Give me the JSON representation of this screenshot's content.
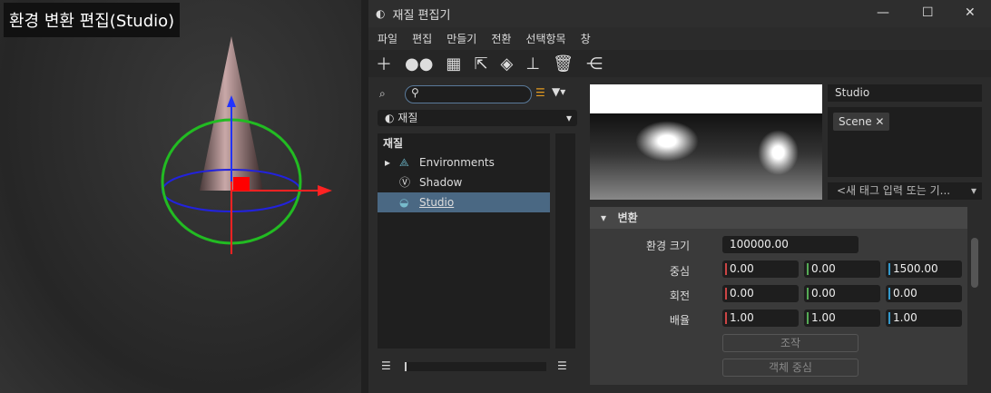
{
  "viewport": {
    "title": "환경 변환 편집(Studio)"
  },
  "window": {
    "title": "재질 편집기",
    "menu": [
      "파일",
      "편집",
      "만들기",
      "전환",
      "선택항목",
      "창"
    ]
  },
  "left": {
    "dropdown": "재질",
    "tree_header": "재질",
    "items": [
      "Environments",
      "Shadow",
      "Studio"
    ]
  },
  "right": {
    "name": "Studio",
    "tag": "Scene",
    "tag_placeholder": "<새 태그 입력 또는 기...",
    "section": "변환",
    "env_size_label": "환경 크기",
    "env_size": "100000.00",
    "rows": [
      {
        "label": "중심",
        "x": "0.00",
        "y": "0.00",
        "z": "1500.00"
      },
      {
        "label": "회전",
        "x": "0.00",
        "y": "0.00",
        "z": "0.00"
      },
      {
        "label": "배율",
        "x": "1.00",
        "y": "1.00",
        "z": "1.00"
      }
    ],
    "btn_manip": "조작",
    "btn_center": "객체 중심"
  }
}
